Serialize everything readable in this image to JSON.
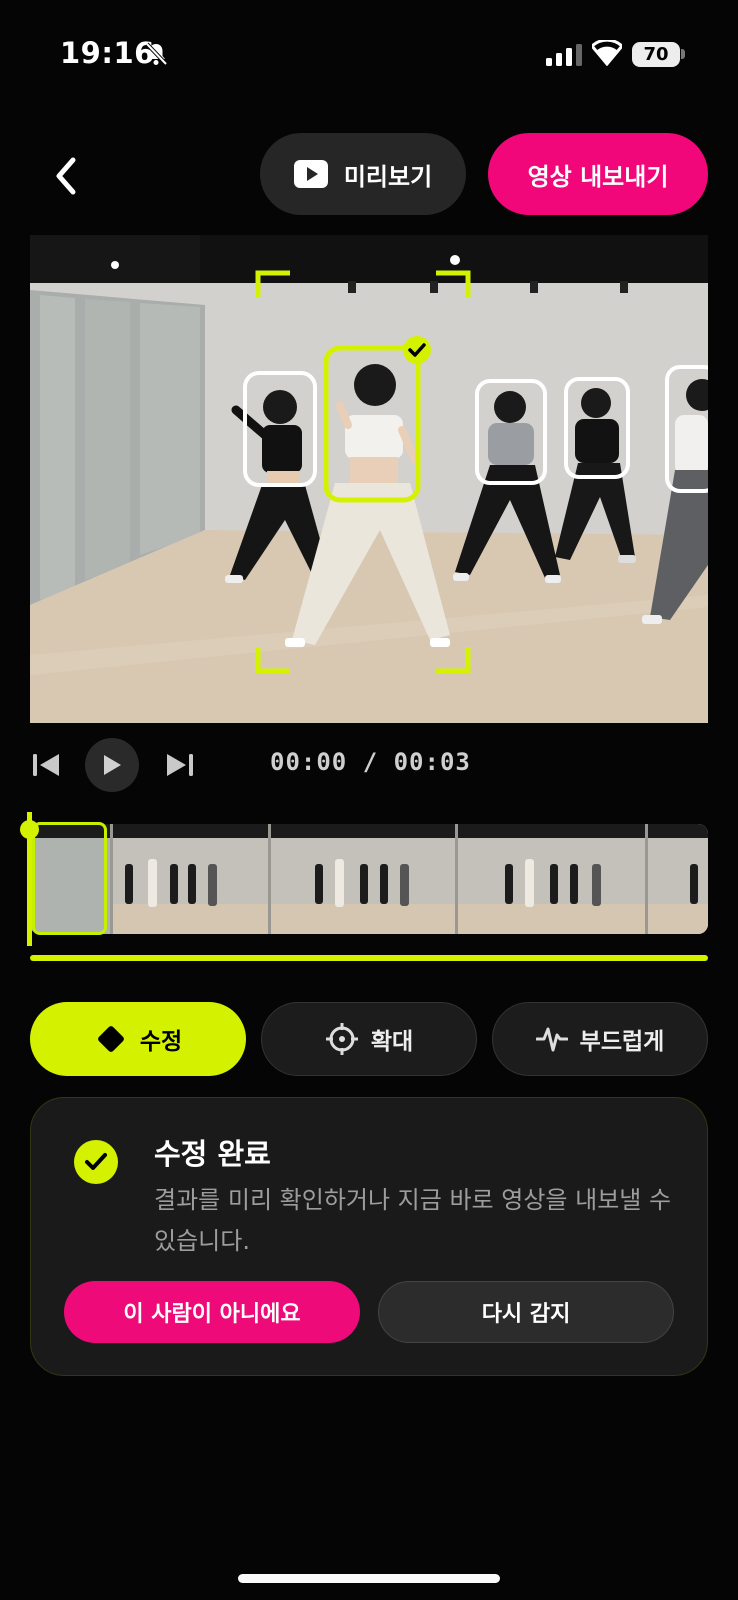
{
  "status_bar": {
    "time": "19:16",
    "battery": "70"
  },
  "toolbar": {
    "preview_label": "미리보기",
    "export_label": "영상 내보내기"
  },
  "player": {
    "timecode": "00:00 / 00:03"
  },
  "tabs": [
    {
      "label": "수정",
      "icon": "diamond-icon",
      "active": true
    },
    {
      "label": "확대",
      "icon": "crosshair-icon",
      "active": false
    },
    {
      "label": "부드럽게",
      "icon": "waveform-icon",
      "active": false
    }
  ],
  "result": {
    "title": "수정 완료",
    "description": "결과를 미리 확인하거나 지금 바로 영상을 내보낼 수 있습니다.",
    "not_person_label": "이 사람이 아니에요",
    "redetect_label": "다시 감지"
  },
  "colors": {
    "accent": "#d4f200",
    "brand_pink": "#f1077a",
    "background": "#050505"
  }
}
